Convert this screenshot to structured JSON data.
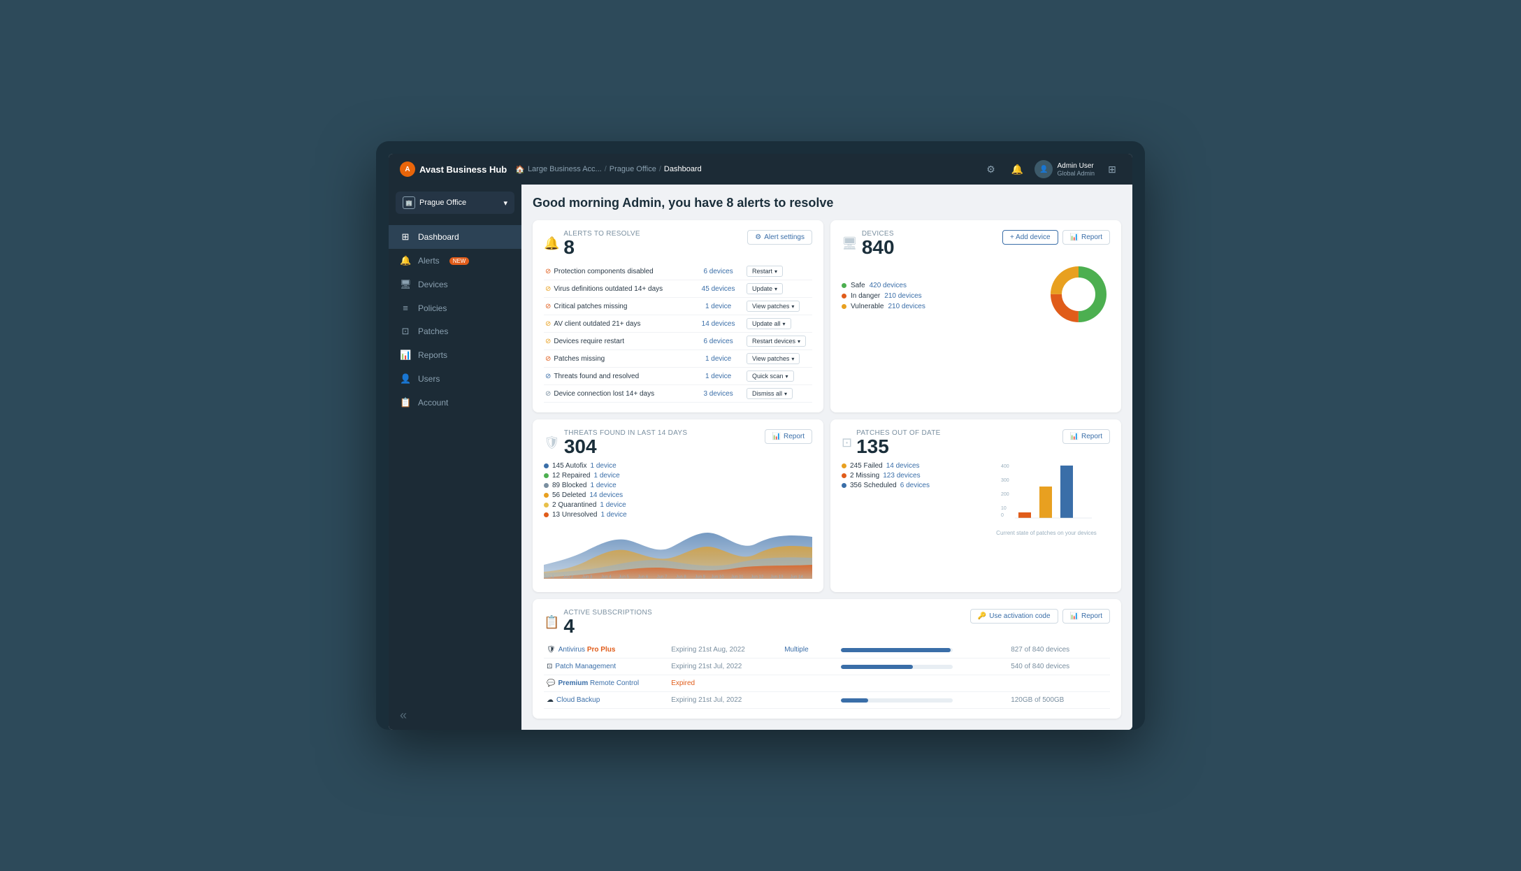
{
  "brand": {
    "name": "Avast Business Hub",
    "logo_text": "A"
  },
  "breadcrumb": {
    "root": "Large Business Acc...",
    "office": "Prague Office",
    "current": "Dashboard"
  },
  "topbar": {
    "user_name": "Admin User",
    "user_role": "Global Admin",
    "settings_icon": "⚙",
    "notification_icon": "🔔",
    "user_icon": "👤",
    "grid_icon": "⊞"
  },
  "sidebar": {
    "org_name": "Prague Office",
    "nav_items": [
      {
        "id": "dashboard",
        "label": "Dashboard",
        "icon": "⊞",
        "active": true
      },
      {
        "id": "alerts",
        "label": "Alerts",
        "icon": "🔔",
        "badge": "NEW"
      },
      {
        "id": "devices",
        "label": "Devices",
        "icon": "🖥"
      },
      {
        "id": "policies",
        "label": "Policies",
        "icon": "≡"
      },
      {
        "id": "patches",
        "label": "Patches",
        "icon": "⊡"
      },
      {
        "id": "reports",
        "label": "Reports",
        "icon": "📊"
      },
      {
        "id": "users",
        "label": "Users",
        "icon": "👤"
      },
      {
        "id": "account",
        "label": "Account",
        "icon": "📋"
      }
    ],
    "collapse_icon": "«"
  },
  "page": {
    "greeting": "Good morning Admin, you have 8 alerts to resolve"
  },
  "alerts_card": {
    "label": "Alerts to resolve",
    "count": "8",
    "button": "Alert settings",
    "rows": [
      {
        "icon_color": "#e05c1a",
        "name": "Protection components disabled",
        "count": "6 devices",
        "action": "Restart"
      },
      {
        "icon_color": "#e8a020",
        "name": "Virus definitions outdated 14+ days",
        "count": "45 devices",
        "action": "Update"
      },
      {
        "icon_color": "#e05c1a",
        "name": "Critical patches missing",
        "count": "1 device",
        "action": "View patches"
      },
      {
        "icon_color": "#e8a020",
        "name": "AV client outdated 21+ days",
        "count": "14 devices",
        "action": "Update all"
      },
      {
        "icon_color": "#e8a020",
        "name": "Devices require restart",
        "count": "6 devices",
        "action": "Restart devices"
      },
      {
        "icon_color": "#e05c1a",
        "name": "Patches missing",
        "count": "1 device",
        "action": "View patches"
      },
      {
        "icon_color": "#3a6ea8",
        "name": "Threats found and resolved",
        "count": "1 device",
        "action": "Quick scan"
      },
      {
        "icon_color": "#7a8fa0",
        "name": "Device connection lost 14+ days",
        "count": "3 devices",
        "action": "Dismiss all"
      }
    ]
  },
  "devices_card": {
    "label": "Devices",
    "count": "840",
    "btn_add": "+ Add device",
    "btn_report": "Report",
    "stats": [
      {
        "color": "#4caf50",
        "label": "Safe",
        "link": "420 devices",
        "percent": 50
      },
      {
        "color": "#e05c1a",
        "label": "In danger",
        "link": "210 devices",
        "percent": 25
      },
      {
        "color": "#e8a020",
        "label": "Vulnerable",
        "link": "210 devices",
        "percent": 25
      }
    ],
    "donut": {
      "segments": [
        {
          "color": "#4caf50",
          "value": 50
        },
        {
          "color": "#e05c1a",
          "value": 25
        },
        {
          "color": "#e8a020",
          "value": 25
        }
      ]
    }
  },
  "threats_card": {
    "label": "Threats found in last 14 days",
    "count": "304",
    "btn_report": "Report",
    "stats": [
      {
        "color": "#3a6ea8",
        "label": "145 Autofix",
        "link": "1 device"
      },
      {
        "color": "#4caf50",
        "label": "12 Repaired",
        "link": "1 device"
      },
      {
        "color": "#7a8fa0",
        "label": "89 Blocked",
        "link": "1 device"
      },
      {
        "color": "#e8a020",
        "label": "56 Deleted",
        "link": "14 devices"
      },
      {
        "color": "#e8c04a",
        "label": "2 Quarantined",
        "link": "1 device"
      },
      {
        "color": "#e05c1a",
        "label": "13 Unresolved",
        "link": "1 device"
      }
    ],
    "chart_labels": [
      "Jun 1",
      "Jun 2",
      "Jun 3",
      "Jun 4",
      "Jun 5",
      "Jun 6",
      "Jun 7",
      "Jun 8",
      "Jun 9",
      "Jun 10",
      "Jun 11",
      "Jun 12",
      "Jun 13",
      "Jun 14"
    ]
  },
  "patches_card": {
    "label": "Patches out of date",
    "count": "135",
    "btn_report": "Report",
    "stats": [
      {
        "color": "#e8a020",
        "label": "245 Failed",
        "link": "14 devices"
      },
      {
        "color": "#e05c1a",
        "label": "2 Missing",
        "link": "123 devices"
      },
      {
        "color": "#3a6ea8",
        "label": "356 Scheduled",
        "link": "6 devices"
      }
    ],
    "chart_note": "Current state of patches on your devices",
    "bars": [
      {
        "color": "#e05c1a",
        "height": 15,
        "value": 10
      },
      {
        "color": "#e8a020",
        "height": 55,
        "value": 245
      },
      {
        "color": "#3a6ea8",
        "height": 90,
        "value": 356
      }
    ],
    "y_labels": [
      "400",
      "300",
      "200",
      "10",
      "0"
    ]
  },
  "subscriptions_card": {
    "label": "Active subscriptions",
    "count": "4",
    "btn_activation": "Use activation code",
    "btn_report": "Report",
    "rows": [
      {
        "icon": "🛡",
        "name_prefix": "Antivirus ",
        "name_highlight": "Pro Plus",
        "highlight_class": "pro",
        "expiry": "Expiring 21st Aug, 2022",
        "multi": "Multiple",
        "progress": 98,
        "usage": "827 of 840 devices"
      },
      {
        "icon": "⊡",
        "name_prefix": "Patch Management",
        "name_highlight": "",
        "highlight_class": "",
        "expiry": "Expiring 21st Jul, 2022",
        "multi": "",
        "progress": 64,
        "usage": "540 of 840 devices"
      },
      {
        "icon": "💬",
        "name_prefix": "",
        "name_highlight": "Premium",
        "highlight_class": "premium",
        "name_suffix": " Remote Control",
        "expiry": "Expired",
        "expiry_class": "expired",
        "multi": "",
        "progress": 0,
        "usage": ""
      },
      {
        "icon": "☁",
        "name_prefix": "Cloud Backup",
        "name_highlight": "",
        "highlight_class": "",
        "expiry": "Expiring 21st Jul, 2022",
        "multi": "",
        "progress": 24,
        "usage": "120GB of 500GB"
      }
    ]
  }
}
